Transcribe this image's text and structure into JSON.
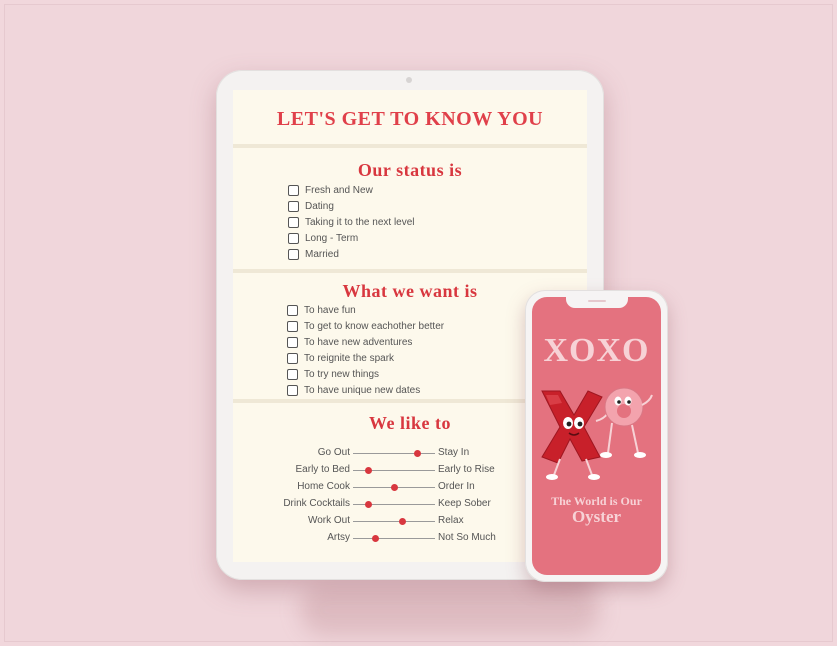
{
  "tablet": {
    "title": "LET'S GET TO KNOW YOU",
    "status": {
      "heading": "Our status is",
      "options": [
        "Fresh and New",
        "Dating",
        "Taking it to the next level",
        "Long - Term",
        "Married"
      ]
    },
    "want": {
      "heading": "What we want is",
      "options": [
        "To have fun",
        "To get to know eachother better",
        "To have new adventures",
        "To reignite the spark",
        "To try new things",
        "To have unique new dates"
      ]
    },
    "like": {
      "heading": "We like to",
      "sliders": [
        {
          "left": "Go Out",
          "right": "Stay In",
          "value": 0.78
        },
        {
          "left": "Early to Bed",
          "right": "Early to Rise",
          "value": 0.18
        },
        {
          "left": "Home Cook",
          "right": "Order In",
          "value": 0.5
        },
        {
          "left": "Drink Cocktails",
          "right": "Keep Sober",
          "value": 0.18
        },
        {
          "left": "Work Out",
          "right": "Relax",
          "value": 0.6
        },
        {
          "left": "Artsy",
          "right": "Not So Much",
          "value": 0.27
        }
      ]
    }
  },
  "phone": {
    "headline": "XOXO",
    "tagline_line1": "The World is Our",
    "tagline_line2": "Oyster"
  },
  "colors": {
    "background": "#f1d7dc",
    "accent": "#d8373f",
    "paper": "#fdf9ec",
    "phone_screen": "#e4727f"
  }
}
